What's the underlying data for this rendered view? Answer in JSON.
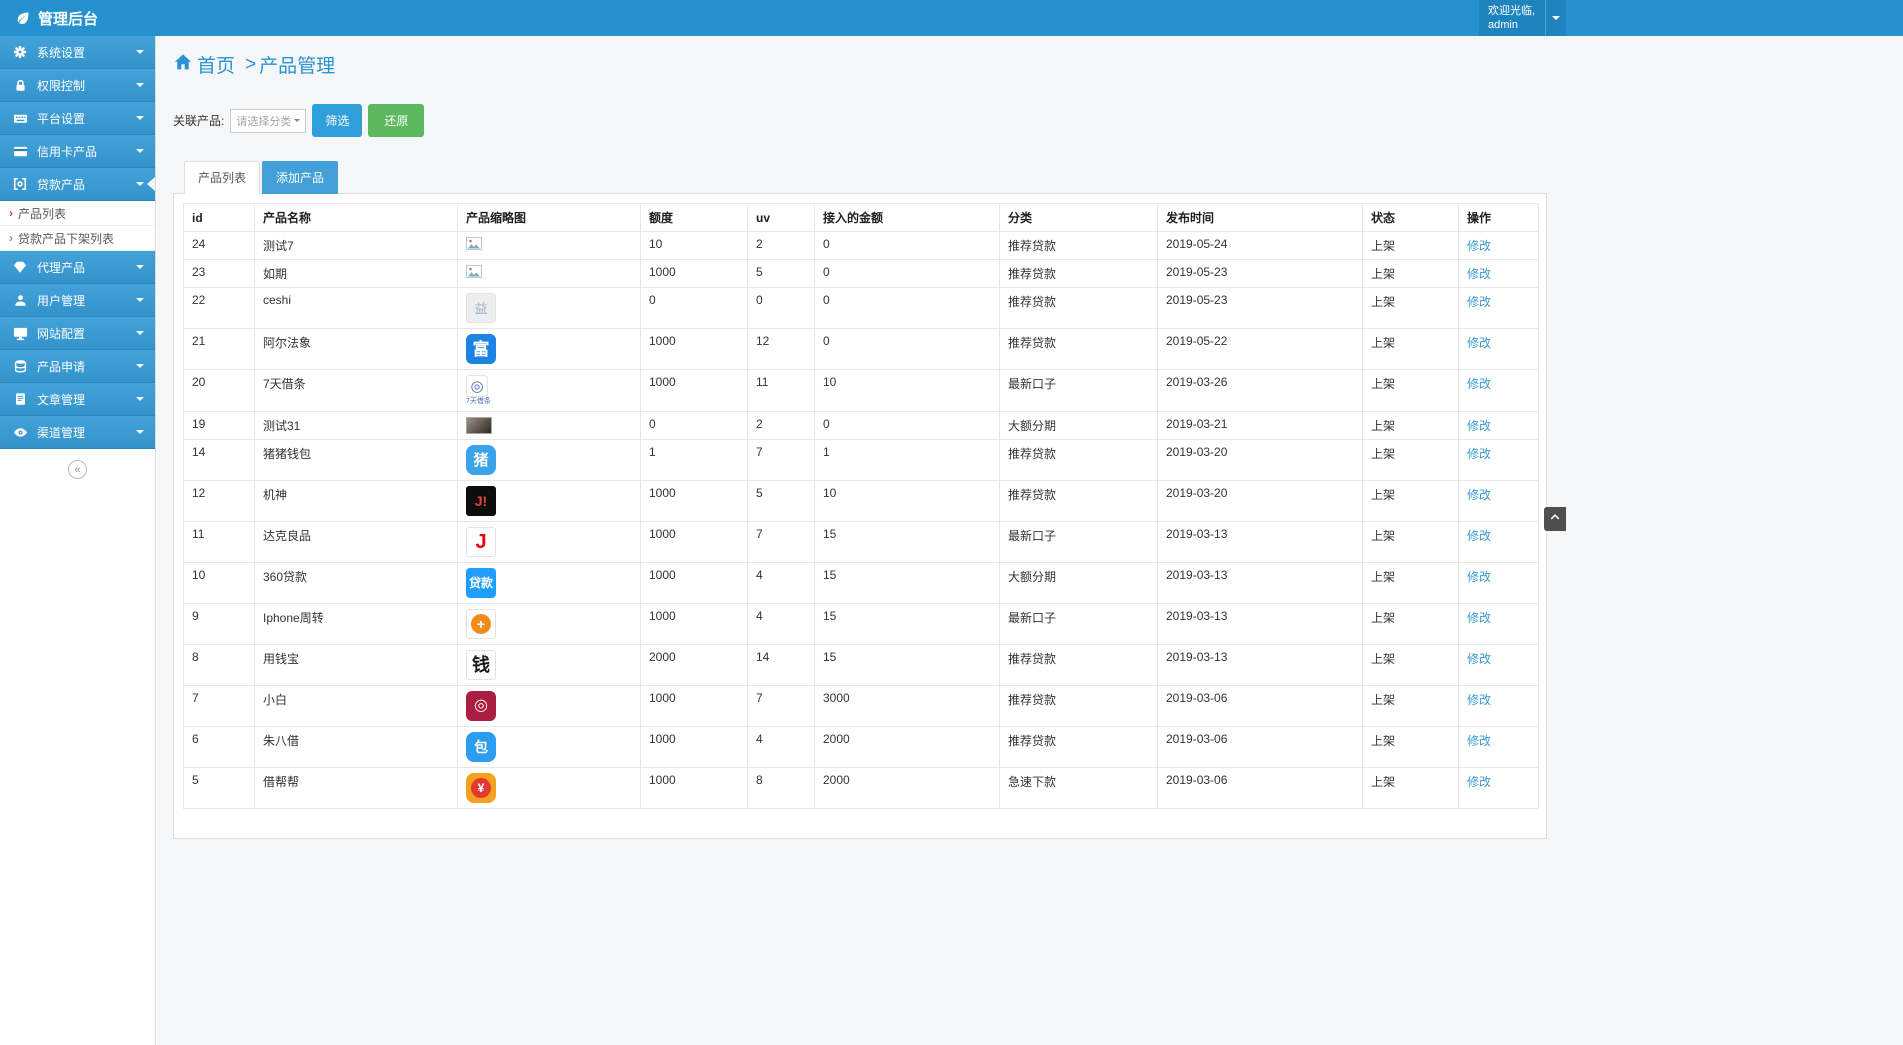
{
  "topbar": {
    "brand_icon": "leaf-icon",
    "title": "管理后台",
    "welcome": "欢迎光临,",
    "username": "admin",
    "dropdown_icon": "chevron-down-icon"
  },
  "sidebar": {
    "collapse_glyph": "«",
    "items": [
      {
        "label": "系统设置",
        "icon": "gear-icon"
      },
      {
        "label": "权限控制",
        "icon": "lock-icon"
      },
      {
        "label": "平台设置",
        "icon": "keyboard-icon"
      },
      {
        "label": "信用卡产品",
        "icon": "credit-card-icon"
      },
      {
        "label": "贷款产品",
        "icon": "loan-bracket-icon",
        "active": true,
        "submenu": [
          {
            "label": "产品列表",
            "active": true
          },
          {
            "label": "贷款产品下架列表",
            "active": false
          }
        ]
      },
      {
        "label": "代理产品",
        "icon": "gem-icon"
      },
      {
        "label": "用户管理",
        "icon": "user-icon"
      },
      {
        "label": "网站配置",
        "icon": "monitor-icon"
      },
      {
        "label": "产品申请",
        "icon": "database-icon"
      },
      {
        "label": "文章管理",
        "icon": "document-icon"
      },
      {
        "label": "渠道管理",
        "icon": "eye-icon"
      }
    ]
  },
  "breadcrumb": {
    "home_icon": "home-icon",
    "home": "首页",
    "sep": ">",
    "current": "产品管理"
  },
  "filter": {
    "label": "关联产品:",
    "select_value": "请选择分类",
    "filter_button": "筛选",
    "reset_button": "还原"
  },
  "tabs": [
    {
      "label": "产品列表",
      "active": true
    },
    {
      "label": "添加产品",
      "active": false
    }
  ],
  "table": {
    "headers": [
      "id",
      "产品名称",
      "产品缩略图",
      "额度",
      "uv",
      "接入的金额",
      "分类",
      "发布时间",
      "状态",
      "操作"
    ],
    "edit_label": "修改",
    "rows": [
      {
        "id": "24",
        "name": "测试7",
        "thumb": {
          "kind": "broken",
          "icon": "broken-image-icon"
        },
        "quota": "10",
        "uv": "2",
        "amount": "0",
        "category": "推荐贷款",
        "date": "2019-05-24",
        "status": "上架"
      },
      {
        "id": "23",
        "name": "如期",
        "thumb": {
          "kind": "broken",
          "icon": "broken-image-icon"
        },
        "quota": "1000",
        "uv": "5",
        "amount": "0",
        "category": "推荐贷款",
        "date": "2019-05-23",
        "status": "上架"
      },
      {
        "id": "22",
        "name": "ceshi",
        "thumb": {
          "kind": "icon",
          "bg": "#eceff1",
          "fg": "#9cb3c6",
          "glyph": "益",
          "fontSize": 13,
          "round": 3,
          "border": true
        },
        "quota": "0",
        "uv": "0",
        "amount": "0",
        "category": "推荐贷款",
        "date": "2019-05-23",
        "status": "上架"
      },
      {
        "id": "21",
        "name": "阿尔法象",
        "thumb": {
          "kind": "icon",
          "bg": "#1d82e2",
          "fg": "#ffffff",
          "glyph": "富",
          "fontSize": 17,
          "round": 6,
          "bold": true
        },
        "quota": "1000",
        "uv": "12",
        "amount": "0",
        "category": "推荐贷款",
        "date": "2019-05-22",
        "status": "上架"
      },
      {
        "id": "20",
        "name": "7天借条",
        "thumb": {
          "kind": "icon",
          "bg": "#ffffff",
          "fg": "#4668b3",
          "glyph": "◎",
          "fontSize": 15,
          "round": 3,
          "border": true,
          "size": 22,
          "sub": "7天借条",
          "subColor": "#4668b3"
        },
        "quota": "1000",
        "uv": "11",
        "amount": "10",
        "category": "最新口子",
        "date": "2019-03-26",
        "status": "上架"
      },
      {
        "id": "19",
        "name": "测试31",
        "thumb": {
          "kind": "photo",
          "icon": "photo-thumbnail"
        },
        "quota": "0",
        "uv": "2",
        "amount": "0",
        "category": "大额分期",
        "date": "2019-03-21",
        "status": "上架"
      },
      {
        "id": "14",
        "name": "猪猪钱包",
        "thumb": {
          "kind": "icon",
          "bg": "#38a3e8",
          "fg": "#ffffff",
          "glyph": "猪",
          "fontSize": 15,
          "round": 8,
          "bold": true
        },
        "quota": "1",
        "uv": "7",
        "amount": "1",
        "category": "推荐贷款",
        "date": "2019-03-20",
        "status": "上架"
      },
      {
        "id": "12",
        "name": "机神",
        "thumb": {
          "kind": "icon",
          "bg": "#0d0d0d",
          "fg": "#e8413c",
          "glyph": "J!",
          "fontSize": 14,
          "round": 3,
          "bold": true
        },
        "quota": "1000",
        "uv": "5",
        "amount": "10",
        "category": "推荐贷款",
        "date": "2019-03-20",
        "status": "上架"
      },
      {
        "id": "11",
        "name": "达克良品",
        "thumb": {
          "kind": "icon",
          "bg": "#ffffff",
          "fg": "#e60012",
          "glyph": "J",
          "fontSize": 20,
          "round": 3,
          "border": true,
          "bold": true
        },
        "quota": "1000",
        "uv": "7",
        "amount": "15",
        "category": "最新口子",
        "date": "2019-03-13",
        "status": "上架"
      },
      {
        "id": "10",
        "name": "360贷款",
        "thumb": {
          "kind": "icon",
          "bg": "#1e9fff",
          "fg": "#ffffff",
          "glyph": "贷款",
          "fontSize": 12,
          "round": 4,
          "bold": true
        },
        "quota": "1000",
        "uv": "4",
        "amount": "15",
        "category": "大额分期",
        "date": "2019-03-13",
        "status": "上架"
      },
      {
        "id": "9",
        "name": "Iphone周转",
        "thumb": {
          "kind": "icon",
          "bg": "#ffffff",
          "border": true,
          "round": 3,
          "circle": "#ef8c1d",
          "fg": "#ffffff",
          "glyph": "+",
          "fontSize": 14,
          "bold": true
        },
        "quota": "1000",
        "uv": "4",
        "amount": "15",
        "category": "最新口子",
        "date": "2019-03-13",
        "status": "上架"
      },
      {
        "id": "8",
        "name": "用钱宝",
        "thumb": {
          "kind": "icon",
          "bg": "#ffffff",
          "fg": "#1a1a1a",
          "glyph": "钱",
          "fontSize": 18,
          "round": 3,
          "border": true,
          "bold": true
        },
        "quota": "2000",
        "uv": "14",
        "amount": "15",
        "category": "推荐贷款",
        "date": "2019-03-13",
        "status": "上架"
      },
      {
        "id": "7",
        "name": "小白",
        "thumb": {
          "kind": "icon",
          "bg": "#ab1e41",
          "fg": "#ffffff",
          "glyph": "◎",
          "fontSize": 16,
          "round": 6
        },
        "quota": "1000",
        "uv": "7",
        "amount": "3000",
        "category": "推荐贷款",
        "date": "2019-03-06",
        "status": "上架"
      },
      {
        "id": "6",
        "name": "朱八借",
        "thumb": {
          "kind": "icon",
          "bg": "#2b9df0",
          "fg": "#ffffff",
          "glyph": "包",
          "fontSize": 14,
          "round": 8,
          "bold": true
        },
        "quota": "1000",
        "uv": "4",
        "amount": "2000",
        "category": "推荐贷款",
        "date": "2019-03-06",
        "status": "上架"
      },
      {
        "id": "5",
        "name": "借帮帮",
        "thumb": {
          "kind": "icon",
          "bg": "#f6a01f",
          "circle": "#e23a30",
          "fg": "#ffffff",
          "glyph": "¥",
          "fontSize": 12,
          "round": 8,
          "bold": true
        },
        "quota": "1000",
        "uv": "8",
        "amount": "2000",
        "category": "急速下款",
        "date": "2019-03-06",
        "status": "上架"
      }
    ]
  },
  "back_to_top_icon": "chevron-up-icon",
  "colors": {
    "topbar": "#2592cf",
    "sidebar_item": "#3a99d0",
    "primary_button": "#2e9fd9",
    "reset_button": "#5cb85c",
    "link": "#3a9bd5",
    "breadcrumb": "#2a93d4"
  }
}
